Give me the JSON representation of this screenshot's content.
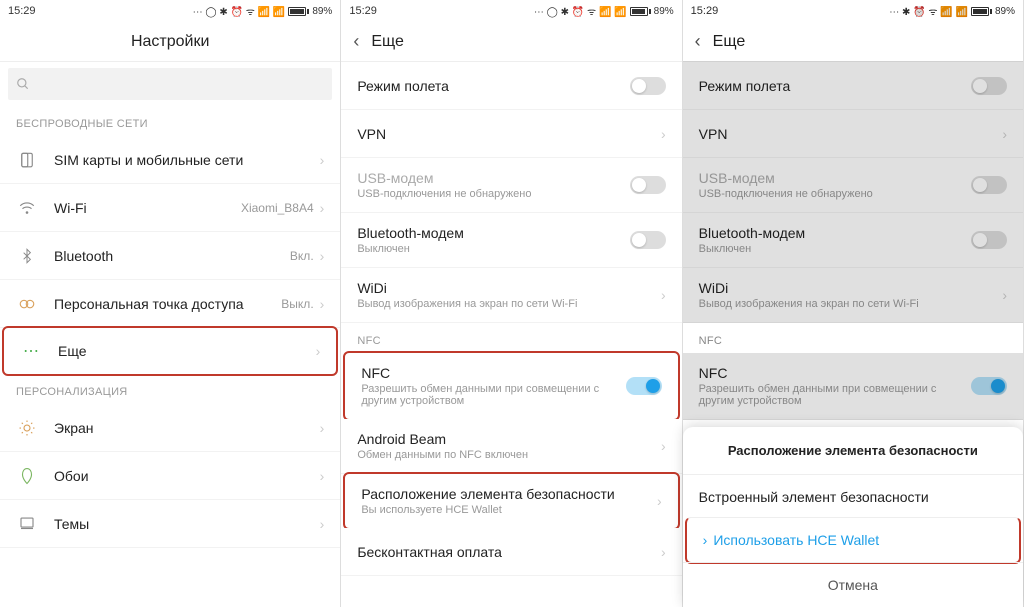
{
  "status": {
    "time": "15:29",
    "battery": "89%"
  },
  "phone1": {
    "title": "Настройки",
    "section_wireless": "БЕСПРОВОДНЫЕ СЕТИ",
    "section_personal": "ПЕРСОНАЛИЗАЦИЯ",
    "sim": "SIM карты и мобильные сети",
    "wifi": "Wi-Fi",
    "wifi_val": "Xiaomi_B8A4",
    "bt": "Bluetooth",
    "bt_val": "Вкл.",
    "hotspot": "Персональная точка доступа",
    "hotspot_val": "Выкл.",
    "more": "Еще",
    "screen": "Экран",
    "wallpaper": "Обои",
    "themes": "Темы"
  },
  "phone2": {
    "title": "Еще",
    "airplane": "Режим полета",
    "vpn": "VPN",
    "usb": "USB-модем",
    "usb_sub": "USB-подключения не обнаружено",
    "btm": "Bluetooth-модем",
    "btm_sub": "Выключен",
    "widi": "WiDi",
    "widi_sub": "Вывод изображения на экран по сети Wi-Fi",
    "nfc_section": "NFC",
    "nfc": "NFC",
    "nfc_sub": "Разрешить обмен данными при совмещении с другим устройством",
    "beam": "Android Beam",
    "beam_sub": "Обмен данными по NFC включен",
    "sec": "Расположение элемента безопасности",
    "sec_sub": "Вы используете HCE Wallet",
    "contactless": "Бесконтактная оплата"
  },
  "sheet": {
    "title": "Расположение элемента безопасности",
    "opt1": "Встроенный элемент безопасности",
    "opt2": "Использовать HCE Wallet",
    "cancel": "Отмена"
  }
}
